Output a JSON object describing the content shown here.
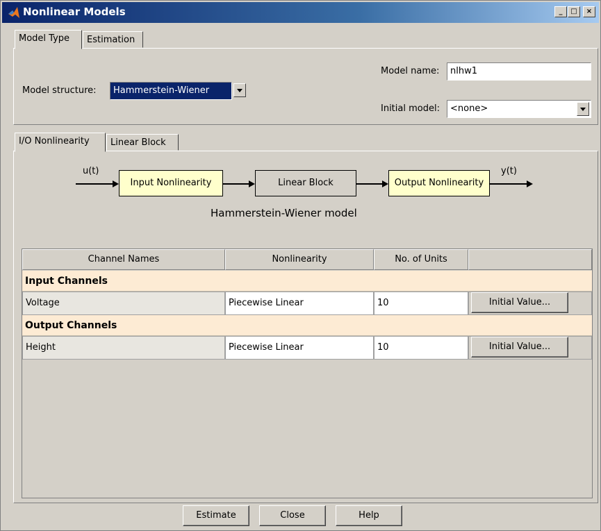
{
  "window": {
    "title": "Nonlinear Models",
    "minimize": "_",
    "maximize": "□",
    "close": "×"
  },
  "main_tabs": [
    {
      "label": "Model Type",
      "active": true
    },
    {
      "label": "Estimation",
      "active": false
    }
  ],
  "model": {
    "structure_label": "Model structure:",
    "structure_value": "Hammerstein-Wiener",
    "name_label": "Model name:",
    "name_value": "nlhw1",
    "initial_label": "Initial model:",
    "initial_value": "<none>"
  },
  "sub_tabs": [
    {
      "label": "I/O Nonlinearity",
      "active": true
    },
    {
      "label": "Linear Block",
      "active": false
    }
  ],
  "diagram": {
    "input_signal": "u(t)",
    "output_signal": "y(t)",
    "block1": "Input Nonlinearity",
    "block2": "Linear Block",
    "block3": "Output Nonlinearity",
    "caption": "Hammerstein-Wiener model"
  },
  "table": {
    "headers": [
      "Channel Names",
      "Nonlinearity",
      "No. of Units",
      ""
    ],
    "groups": [
      {
        "title": "Input Channels",
        "rows": [
          {
            "name": "Voltage",
            "nonlinearity": "Piecewise Linear",
            "units": "10",
            "action": "Initial Value..."
          }
        ]
      },
      {
        "title": "Output Channels",
        "rows": [
          {
            "name": "Height",
            "nonlinearity": "Piecewise Linear",
            "units": "10",
            "action": "Initial Value..."
          }
        ]
      }
    ]
  },
  "footer": {
    "estimate": "Estimate",
    "close": "Close",
    "help": "Help"
  },
  "colors": {
    "titlebar": "#0a246a",
    "block_fill": "#ffffcc",
    "group_row": "#fdebd4",
    "selected_combo": "#0a246a"
  }
}
